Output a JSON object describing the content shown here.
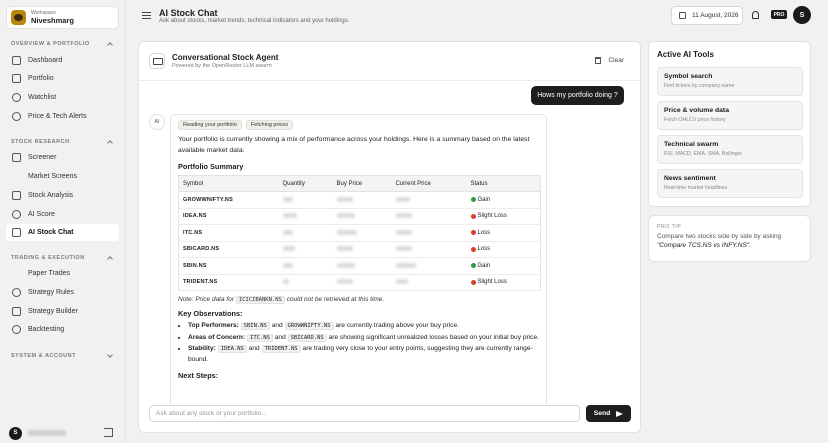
{
  "workspace": {
    "label": "Workspace",
    "name": "Niveshmarg"
  },
  "sidebar": {
    "sections": [
      {
        "title": "OVERVIEW & PORTFOLIO",
        "collapsed": false,
        "items": [
          {
            "label": "Dashboard",
            "icon": "home-icon"
          },
          {
            "label": "Portfolio",
            "icon": "briefcase-icon"
          },
          {
            "label": "Watchlist",
            "icon": "eye-icon"
          },
          {
            "label": "Price & Tech Alerts",
            "icon": "bell-icon"
          }
        ]
      },
      {
        "title": "STOCK RESEARCH",
        "collapsed": false,
        "items": [
          {
            "label": "Screener",
            "icon": "filter-icon"
          },
          {
            "label": "Market Screens",
            "icon": "trending-icon"
          },
          {
            "label": "Stock Analysis",
            "icon": "chart-icon"
          },
          {
            "label": "AI Score",
            "icon": "target-icon"
          },
          {
            "label": "AI Stock Chat",
            "icon": "chat-icon",
            "active": true
          }
        ]
      },
      {
        "title": "TRADING & EXECUTION",
        "collapsed": false,
        "items": [
          {
            "label": "Paper Trades",
            "icon": "swap-icon"
          },
          {
            "label": "Strategy Rules",
            "icon": "check-circle-icon"
          },
          {
            "label": "Strategy Builder",
            "icon": "wrench-icon"
          },
          {
            "label": "Backtesting",
            "icon": "history-icon"
          }
        ]
      },
      {
        "title": "SYSTEM & ACCOUNT",
        "collapsed": true,
        "items": []
      }
    ]
  },
  "user": {
    "initial": "S"
  },
  "header": {
    "title": "AI Stock Chat",
    "subtitle": "Ask about stocks, market trends, technical indicators and your holdings.",
    "date": "11 August, 2026",
    "pro_badge": "PRO",
    "avatar_initial": "S"
  },
  "chat": {
    "agent_title": "Conversational Stock Agent",
    "agent_subtitle": "Powered by the OpenRouter LLM swarm",
    "clear_label": "Clear",
    "user_message": "Hows my portfolio doing ?",
    "ai_label": "AI",
    "chips": [
      "Reading your portfolio",
      "Fetching prices"
    ],
    "intro": "Your portfolio is currently showing a mix of performance across your holdings. Here is a summary based on the latest available market data:",
    "summary_heading": "Portfolio Summary",
    "table": {
      "headers": [
        "Symbol",
        "Quantity",
        "Buy Price",
        "Current Price",
        "Status"
      ],
      "rows": [
        {
          "symbol": "GROWWNIFTY.NS",
          "status": "Gain",
          "status_color": "#2e9e3e"
        },
        {
          "symbol": "IDEA.NS",
          "status": "Slight Loss",
          "status_color": "#d6402b"
        },
        {
          "symbol": "ITC.NS",
          "status": "Loss",
          "status_color": "#d6402b"
        },
        {
          "symbol": "SBICARD.NS",
          "status": "Loss",
          "status_color": "#d6402b"
        },
        {
          "symbol": "SBIN.NS",
          "status": "Gain",
          "status_color": "#2e9e3e"
        },
        {
          "symbol": "TRIDENT.NS",
          "status": "Slight Loss",
          "status_color": "#d6402b"
        }
      ]
    },
    "note_prefix": "Note: Price data for",
    "note_code": "ICICIBANKN.NS",
    "note_suffix": "could not be retrieved at this time.",
    "observations_heading": "Key Observations:",
    "observations": [
      {
        "label": "Top Performers:",
        "code1": "SBIN.NS",
        "mid": "and",
        "code2": "GROWWNIFTY.NS",
        "text": "are currently trading above your buy price."
      },
      {
        "label": "Areas of Concern:",
        "code1": "ITC.NS",
        "mid": "and",
        "code2": "SBICARD.NS",
        "text": "are showing significant unrealized losses based on your initial buy price."
      },
      {
        "label": "Stability:",
        "code1": "IDEA.NS",
        "mid": "and",
        "code2": "TRIDENT.NS",
        "text": "are trading very close to your entry points, suggesting they are currently range-bound."
      }
    ],
    "next_heading": "Next Steps:",
    "input_placeholder": "Ask about any stock or your portfolio...",
    "send_label": "Send"
  },
  "tools": {
    "title": "Active AI Tools",
    "items": [
      {
        "name": "Symbol search",
        "desc": "Find tickers by company name"
      },
      {
        "name": "Price & volume data",
        "desc": "Fetch OHLCV price history"
      },
      {
        "name": "Technical swarm",
        "desc": "RSI, MACD, EMA, SMA, Bollinger"
      },
      {
        "name": "News sentiment",
        "desc": "Real-time market headlines"
      }
    ]
  },
  "tip": {
    "label": "PRO TIP",
    "text": "Compare two stocks side by side by asking",
    "example": "\"Compare TCS.NS vs INFY.NS\"."
  }
}
